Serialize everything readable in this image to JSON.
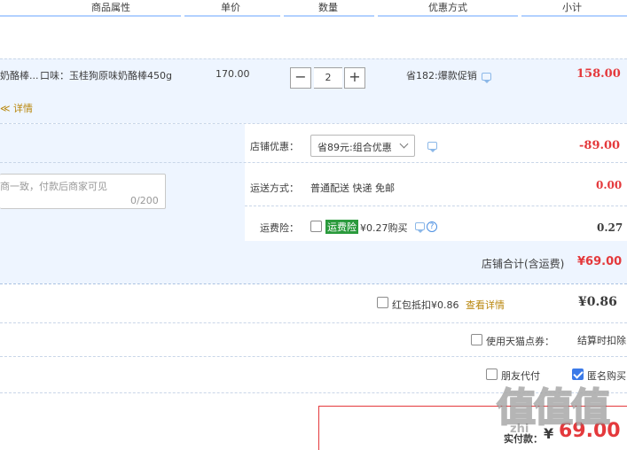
{
  "header": {
    "columns": [
      "商品属性",
      "单价",
      "数量",
      "优惠方式",
      "小计"
    ]
  },
  "item": {
    "name": "奶酪棒...",
    "attr": "口味：玉桂狗原味奶酪棒450g",
    "unit_price": "170.00",
    "quantity": "2",
    "minus": "−",
    "plus": "+",
    "promo": "省182:爆款促销",
    "subtotal": "158.00",
    "detail_prefix": "≪",
    "detail_link": "详情"
  },
  "shop": {
    "discount_label": "店铺优惠：",
    "discount_value": "省89元:组合优惠",
    "discount_amount": "-89.00",
    "message_placeholder": "商一致，付款后商家可见",
    "message_count": "0/200",
    "shipping_label": "运送方式：",
    "shipping_value": "普通配送 快递 免邮",
    "shipping_amount": "0.00",
    "insurance_label": "运费险：",
    "insurance_tag": "运费险",
    "insurance_text": "¥0.27购买",
    "insurance_amount": "0.27",
    "total_label": "店铺合计(含运费)",
    "total_value": "¥69.00"
  },
  "redpacket": {
    "label": "红包抵扣¥0.86",
    "link": "查看详情",
    "amount": "¥0.86"
  },
  "coupon": {
    "label": "使用天猫点券：",
    "value": "结算时扣除"
  },
  "options": {
    "friend_pay": "朋友代付",
    "anonymous": "匿名购买"
  },
  "pay": {
    "label": "实付款：",
    "currency": "¥",
    "amount": "69.00"
  },
  "watermark": {
    "text": "值值值",
    "sub": "zhi"
  },
  "colors": {
    "accent_red": "#e4393c",
    "header_line": "#b2d1ff",
    "row_bg": "#eef5ff",
    "link_orange": "#b8860b"
  }
}
